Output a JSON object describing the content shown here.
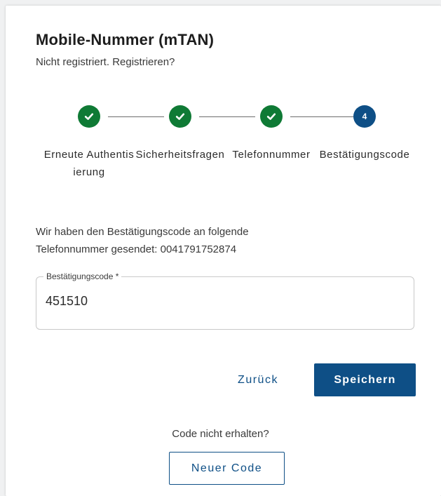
{
  "header": {
    "title": "Mobile-Nummer (mTAN)",
    "subtitle": "Nicht registriert. Registrieren?"
  },
  "stepper": {
    "steps": [
      {
        "label": "Erneute Authentisierung",
        "status": "done",
        "icon": "check-icon"
      },
      {
        "label": "Sicherheitsfragen",
        "status": "done",
        "icon": "check-icon"
      },
      {
        "label": "Telefonnummer",
        "status": "done",
        "icon": "check-icon"
      },
      {
        "label": "Bestätigungscode",
        "status": "active",
        "number": "4"
      }
    ]
  },
  "info": {
    "line1": "Wir haben den Bestätigungscode an folgende",
    "line2": "Telefonnummer gesendet: 0041791752874"
  },
  "code_field": {
    "label": "Bestätigungscode *",
    "value": "451510"
  },
  "actions": {
    "back_label": "Zurück",
    "save_label": "Speichern"
  },
  "resend": {
    "prompt": "Code nicht erhalten?",
    "button_label": "Neuer Code"
  },
  "colors": {
    "primary": "#0e4f86",
    "success": "#0f7a35"
  }
}
